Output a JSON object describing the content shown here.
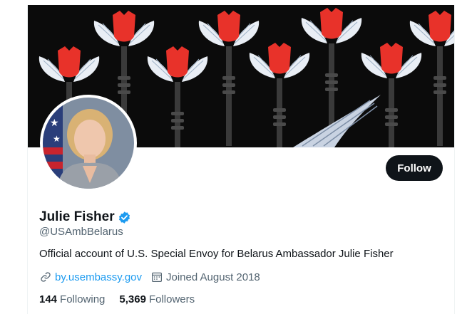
{
  "profile": {
    "display_name": "Julie Fisher",
    "handle": "@USAmbBelarus",
    "bio": "Official account of U.S. Special Envoy for Belarus Ambassador Julie Fisher",
    "website": "by.usembassy.gov",
    "joined": "Joined August 2018",
    "verified": true
  },
  "actions": {
    "follow_label": "Follow"
  },
  "stats": {
    "following_count": "144",
    "following_label": "Following",
    "followers_count": "5,369",
    "followers_label": "Followers"
  },
  "icons": {
    "link": "link-icon",
    "calendar": "calendar-icon",
    "verified": "verified-badge-icon"
  },
  "colors": {
    "accent": "#1d9bf0",
    "text_primary": "#0f1419",
    "text_secondary": "#536471",
    "button_bg": "#0f1419",
    "banner_bg": "#0b0b0b",
    "flower_red": "#e8322a"
  }
}
